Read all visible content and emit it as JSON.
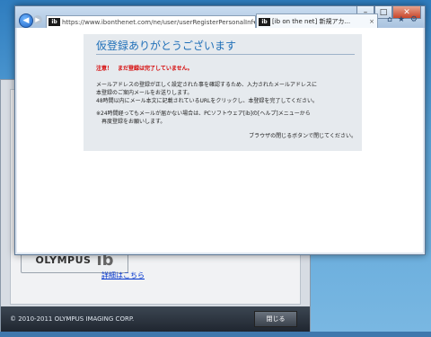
{
  "background_dialog": {
    "brand": "OLYMPUS",
    "logo_mark": "ib",
    "details_link": "詳細はこちら",
    "copyright": "© 2010-2011 OLYMPUS IMAGING CORP.",
    "close_button": "閉じる"
  },
  "browser": {
    "address": "https://www.ibonthenet.com/ne/user/userRegisterPersonalInf",
    "favicon": "ib",
    "tab_title": "[ib on the net] 新規アカ...",
    "icons": [
      "back-icon",
      "forward-icon",
      "lock-icon",
      "refresh-icon",
      "home-icon",
      "favorites-icon",
      "settings-icon"
    ]
  },
  "page": {
    "title": "仮登録ありがとうございます",
    "warning": "注意！　まだ登録は完了していません。",
    "paragraph1": [
      "メールアドレスの登録が正しく設定された事を確認するため、入力されたメールアドレスに",
      "本登録のご案内メールをお送りします。",
      "48時間以内にメール本文に記載されているURLをクリックし、本登録を完了してください。"
    ],
    "paragraph2": [
      "※24時間経ってもメールが届かない場合は、PCソフトウェア[ib]の[ヘルプ]メニューから",
      "　再度登録をお願いします。"
    ],
    "closing": "ブラウザの閉じるボタンで閉じてください。"
  },
  "colors": {
    "title": "#1f6fb8",
    "warning": "#d60000",
    "panel_bg": "#e6eaee"
  }
}
